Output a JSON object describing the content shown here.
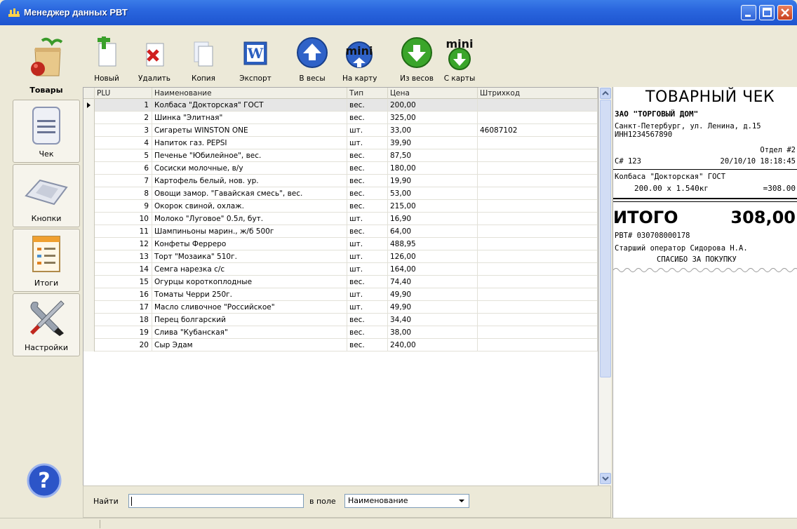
{
  "window": {
    "title": "Менеджер данных РВТ",
    "colors": {
      "titlebar": "#2a66de",
      "close": "#c8401e"
    }
  },
  "nav": {
    "items": [
      {
        "label": "Товары",
        "icon": "grocery-bag-icon",
        "active": true
      },
      {
        "label": "Чек",
        "icon": "receipt-icon",
        "active": false
      },
      {
        "label": "Кнопки",
        "icon": "keyboard-icon",
        "active": false
      },
      {
        "label": "Итоги",
        "icon": "report-icon",
        "active": false
      },
      {
        "label": "Настройки",
        "icon": "tools-icon",
        "active": false
      }
    ],
    "help_icon": "help-icon"
  },
  "toolbar": {
    "new": "Новый",
    "delete": "Удалить",
    "copy": "Копия",
    "export": "Экспорт",
    "to_scales": "В весы",
    "to_card": "На карту",
    "from_scales": "Из весов",
    "from_card": "С карты",
    "mini_label": "mini"
  },
  "grid": {
    "columns": [
      "PLU",
      "Наименование",
      "Тип",
      "Цена",
      "Штрихкод"
    ],
    "rows": [
      {
        "plu": "1",
        "name": "Колбаса \"Докторская\" ГОСТ",
        "type": "вес.",
        "price": "200,00",
        "barcode": ""
      },
      {
        "plu": "2",
        "name": "Шинка \"Элитная\"",
        "type": "вес.",
        "price": "325,00",
        "barcode": ""
      },
      {
        "plu": "3",
        "name": "Сигареты WINSTON ONE",
        "type": "шт.",
        "price": "33,00",
        "barcode": "46087102"
      },
      {
        "plu": "4",
        "name": "Напиток газ. PEPSI",
        "type": "шт.",
        "price": "39,90",
        "barcode": ""
      },
      {
        "plu": "5",
        "name": "Печенье \"Юбилейное\", вес.",
        "type": "вес.",
        "price": "87,50",
        "barcode": ""
      },
      {
        "plu": "6",
        "name": "Сосиски молочные, в/у",
        "type": "вес.",
        "price": "180,00",
        "barcode": ""
      },
      {
        "plu": "7",
        "name": "Картофель белый, нов. ур.",
        "type": "вес.",
        "price": "19,90",
        "barcode": ""
      },
      {
        "plu": "8",
        "name": "Овощи замор. \"Гавайская смесь\", вес.",
        "type": "вес.",
        "price": "53,00",
        "barcode": ""
      },
      {
        "plu": "9",
        "name": "Окорок свиной, охлаж.",
        "type": "вес.",
        "price": "215,00",
        "barcode": ""
      },
      {
        "plu": "10",
        "name": "Молоко \"Луговое\" 0.5л, бут.",
        "type": "шт.",
        "price": "16,90",
        "barcode": ""
      },
      {
        "plu": "11",
        "name": "Шампиньоны марин., ж/б 500г",
        "type": "вес.",
        "price": "64,00",
        "barcode": ""
      },
      {
        "plu": "12",
        "name": "Конфеты Ферреро",
        "type": "шт.",
        "price": "488,95",
        "barcode": ""
      },
      {
        "plu": "13",
        "name": "Торт \"Мозаика\" 510г.",
        "type": "шт.",
        "price": "126,00",
        "barcode": ""
      },
      {
        "plu": "14",
        "name": "Семга нарезка с/с",
        "type": "шт.",
        "price": "164,00",
        "barcode": ""
      },
      {
        "plu": "15",
        "name": "Огурцы короткоплодные",
        "type": "вес.",
        "price": "74,40",
        "barcode": ""
      },
      {
        "plu": "16",
        "name": "Томаты Черри 250г.",
        "type": "шт.",
        "price": "49,90",
        "barcode": ""
      },
      {
        "plu": "17",
        "name": "Масло сливочное \"Российское\"",
        "type": "шт.",
        "price": "49,90",
        "barcode": ""
      },
      {
        "plu": "18",
        "name": "Перец болгарский",
        "type": "вес.",
        "price": "34,40",
        "barcode": ""
      },
      {
        "plu": "19",
        "name": "Слива \"Кубанская\"",
        "type": "вес.",
        "price": "38,00",
        "barcode": ""
      },
      {
        "plu": "20",
        "name": "Сыр Эдам",
        "type": "вес.",
        "price": "240,00",
        "barcode": ""
      }
    ],
    "selected_row": 0
  },
  "search": {
    "find_label": "Найти",
    "find_value": "",
    "field_label": "в поле",
    "field_value": "Наименование"
  },
  "receipt": {
    "title": "ТОВАРНЫЙ ЧЕК",
    "company": "ЗАО \"ТОРГОВЫЙ ДОМ\"",
    "address": "Санкт-Петербург, ул. Ленина, д.15",
    "inn": "ИНН1234567890",
    "dept": "Отдел #2",
    "check_no": "С# 123",
    "datetime": "20/10/10 18:18:45",
    "item_name": "Колбаса \"Докторская\" ГОСТ",
    "item_calc": "200.00 x 1.540кг",
    "item_sum": "=308.00",
    "total_label": "ИТОГО",
    "total_value": "308,00",
    "rvt_no": "РВТ# 030708000178",
    "operator": "Старший оператор Сидорова Н.А.",
    "thanks": "СПАСИБО ЗА ПОКУПКУ"
  }
}
